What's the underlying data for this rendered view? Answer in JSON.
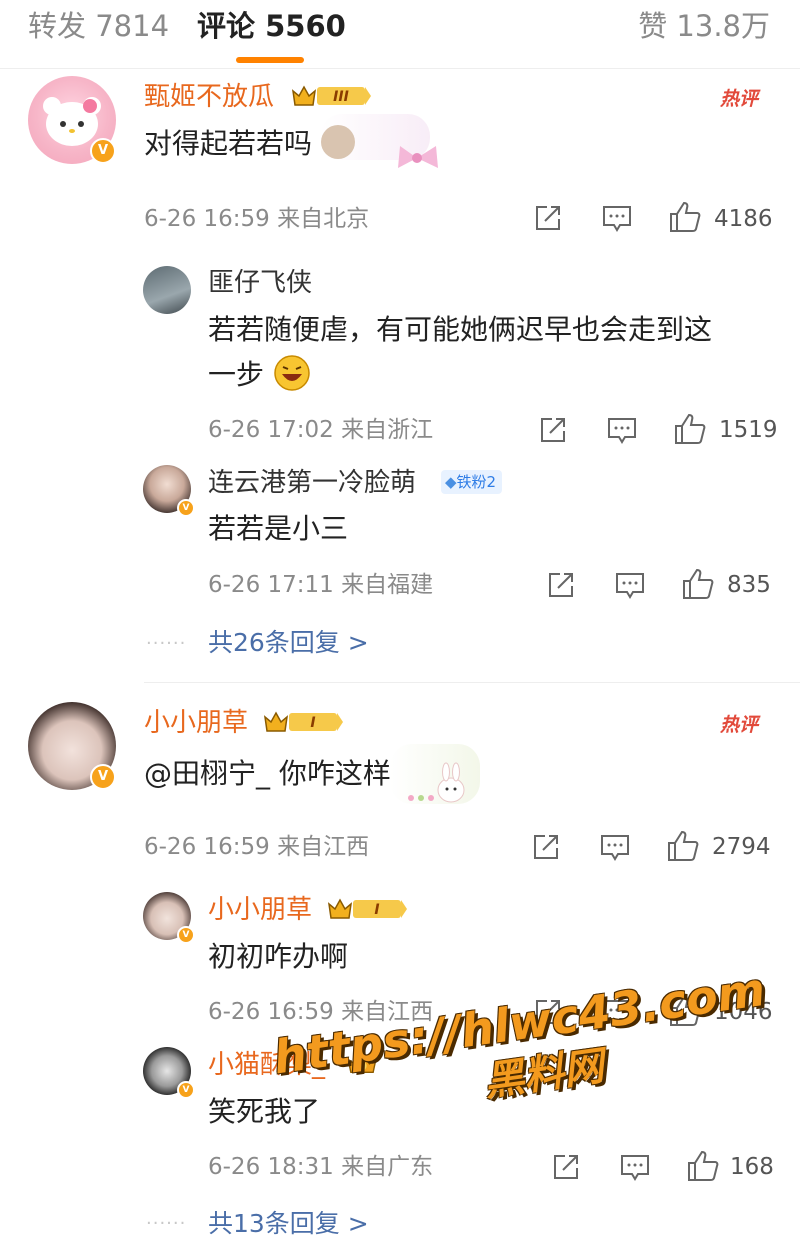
{
  "tabs": {
    "repost": "转发 7814",
    "comments": "评论 5560",
    "likes": "赞 13.8万"
  },
  "hot_label": "热评",
  "watermark": {
    "line1": "https://hlwc43.com",
    "line2": "黑料网"
  },
  "comments": [
    {
      "author": "甄姬不放瓜",
      "level": "III",
      "text": "对得起若若吗",
      "meta": "6-26 16:59 来自北京",
      "likes": "4186",
      "replies": [
        {
          "author": "匪仔飞侠",
          "text_line1": "若若随便虐，有可能她俩迟早也会走到这",
          "text_line2": "一步",
          "meta": "6-26 17:02 来自浙江",
          "likes": "1519"
        },
        {
          "author": "连云港第一冷脸萌",
          "badge": "铁粉2",
          "text": "若若是小三",
          "meta": "6-26 17:11 来自福建",
          "likes": "835"
        }
      ],
      "more": "共26条回复 >"
    },
    {
      "author": "小小朋草",
      "level": "I",
      "text": "@田栩宁_ 你咋这样",
      "meta": "6-26 16:59 来自江西",
      "likes": "2794",
      "replies": [
        {
          "author": "小小朋草",
          "level": "I",
          "text": "初初咋办啊",
          "meta": "6-26 16:59 来自江西",
          "likes": "1046"
        },
        {
          "author": "小猫酥梨_",
          "text": "笑死我了",
          "meta": "6-26 18:31 来自广东",
          "likes": "168"
        }
      ],
      "more": "共13条回复 >"
    }
  ],
  "colors": {
    "accent": "#ff8200",
    "name": "#e8681e",
    "link": "#4a6ea8",
    "hot": "#e24a3b"
  }
}
